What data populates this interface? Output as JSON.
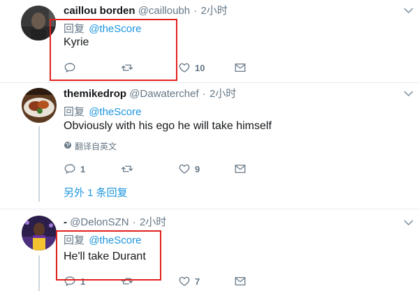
{
  "tweets": [
    {
      "name": "caillou borden",
      "handle": "@cailloubh",
      "time": "2小时",
      "reply_prefix": "回复",
      "reply_to": "@theScore",
      "text": "Kyrie",
      "reply_count": "",
      "retweet_count": "",
      "like_count": "10"
    },
    {
      "name": "themikedrop",
      "handle": "@Dawaterchef",
      "time": "2小时",
      "reply_prefix": "回复",
      "reply_to": "@theScore",
      "text": "Obviously with his ego he will take himself",
      "translate_label": "翻译自英文",
      "reply_count": "1",
      "retweet_count": "",
      "like_count": "9",
      "more_replies": "另外 1 条回复"
    },
    {
      "name": "-",
      "handle": "@DelonSZN",
      "time": "2小时",
      "reply_prefix": "回复",
      "reply_to": "@theScore",
      "text": "He'll take Durant",
      "reply_count": "1",
      "retweet_count": "",
      "like_count": "7"
    }
  ],
  "separator": "·",
  "colors": {
    "accent": "#1b95e0",
    "muted": "#657786",
    "highlight_box": "#e0211d",
    "thread_line": "#ccd6dd"
  },
  "icons": [
    "reply-icon",
    "retweet-icon",
    "like-icon",
    "dm-icon",
    "caret-down-icon",
    "globe-icon"
  ]
}
